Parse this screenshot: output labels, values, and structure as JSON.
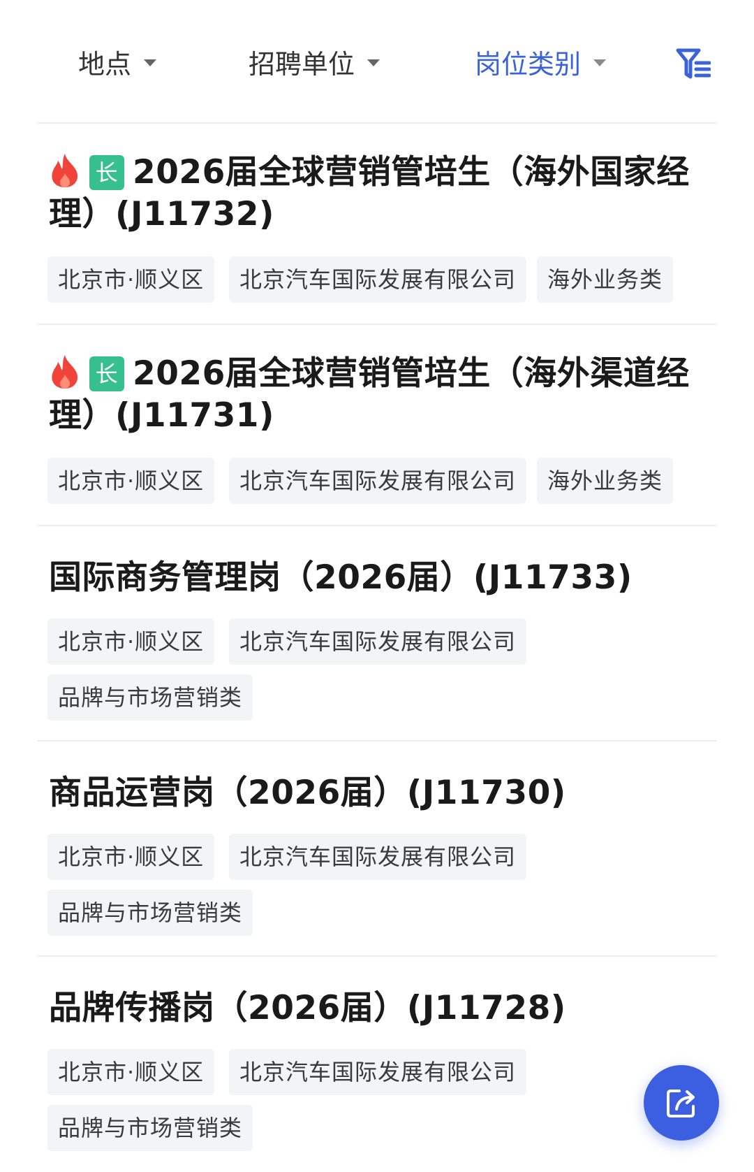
{
  "filters": {
    "location": "地点",
    "company": "招聘单位",
    "category": "岗位类别"
  },
  "jobs": [
    {
      "hot": true,
      "badge": "长",
      "title": "2026届全球营销管培生（海外国家经理）(J11732)",
      "location": "北京市·顺义区",
      "company": "北京汽车国际发展有限公司",
      "category": "海外业务类"
    },
    {
      "hot": true,
      "badge": "长",
      "title": "2026届全球营销管培生（海外渠道经理）(J11731)",
      "location": "北京市·顺义区",
      "company": "北京汽车国际发展有限公司",
      "category": "海外业务类"
    },
    {
      "hot": false,
      "title": "国际商务管理岗（2026届）(J11733)",
      "location": "北京市·顺义区",
      "company": "北京汽车国际发展有限公司",
      "category": "品牌与市场营销类"
    },
    {
      "hot": false,
      "title": "商品运营岗（2026届）(J11730)",
      "location": "北京市·顺义区",
      "company": "北京汽车国际发展有限公司",
      "category": "品牌与市场营销类"
    },
    {
      "hot": false,
      "title": "品牌传播岗（2026届）(J11728)",
      "location": "北京市·顺义区",
      "company": "北京汽车国际发展有限公司",
      "category": "品牌与市场营销类"
    }
  ],
  "icons": {
    "filter": "filter-list-icon",
    "hot": "fire-icon",
    "share": "share-icon"
  },
  "colors": {
    "accent": "#3b63d8",
    "badge": "#36c08d",
    "fire": "#f0443a",
    "fab": "#3b5fe0",
    "tag_bg": "#f3f4f6"
  }
}
